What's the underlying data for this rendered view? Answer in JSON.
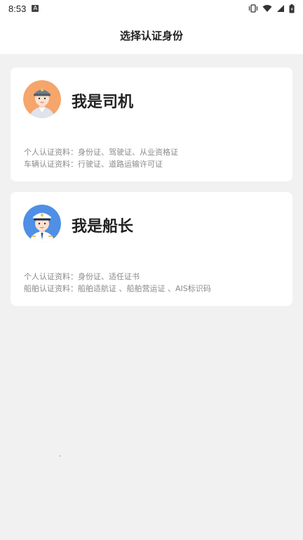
{
  "status_bar": {
    "time": "8:53",
    "icons": [
      "app-a-icon",
      "vibrate-icon",
      "wifi-icon",
      "signal-icon",
      "battery-icon"
    ]
  },
  "header": {
    "title": "选择认证身份"
  },
  "cards": [
    {
      "role": "我是司机",
      "avatar_icon": "driver-avatar-icon",
      "line1": "个人认证资料：身份证、驾驶证、从业资格证",
      "line2": "车辆认证资料：行驶证、道路运输许可证"
    },
    {
      "role": "我是船长",
      "avatar_icon": "captain-avatar-icon",
      "line1": "个人认证资料：身份证、适任证书",
      "line2": "船舶认证资料：船舶适航证 、船舶营运证 、AIS标识码"
    }
  ],
  "colors": {
    "background": "#f1f1f1",
    "card": "#ffffff",
    "driver_avatar_bg": "#f6a56b",
    "captain_avatar_bg": "#4f8fe6",
    "secondary_text": "#8a8a8a"
  }
}
